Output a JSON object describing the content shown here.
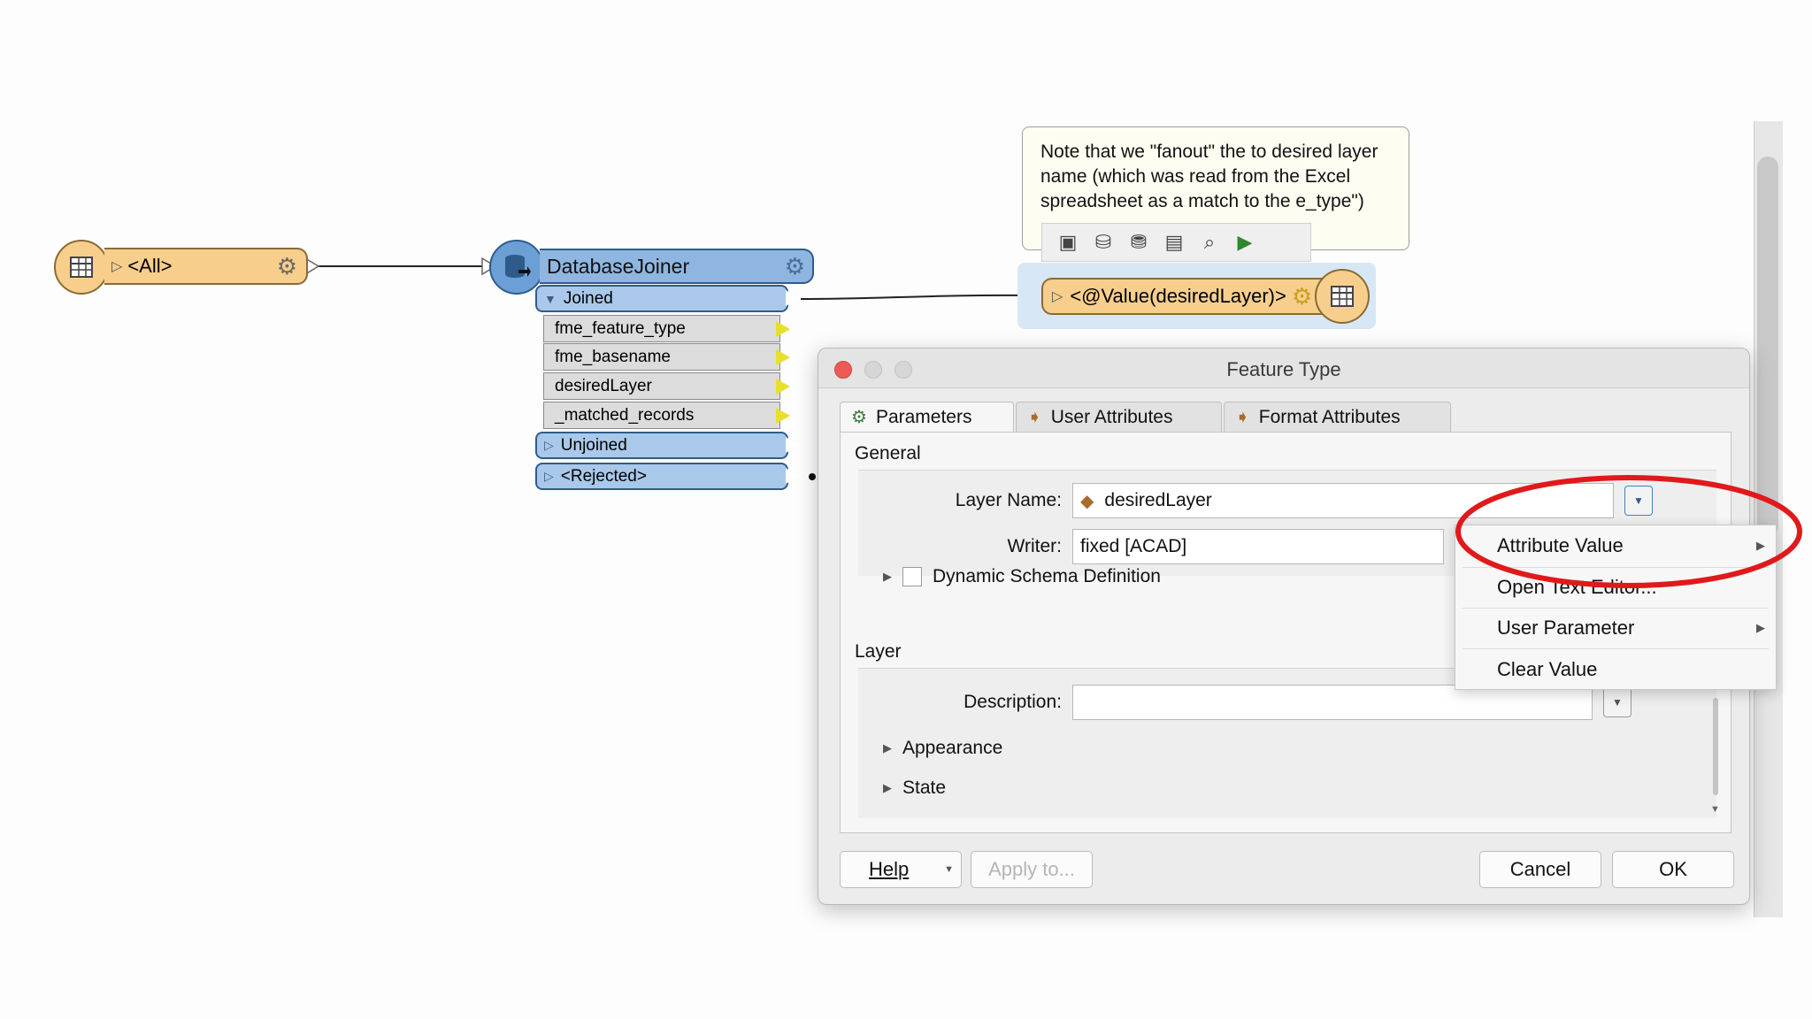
{
  "canvas": {
    "reader": {
      "label": "<All>"
    },
    "joiner": {
      "title": "DatabaseJoiner",
      "ports": {
        "joined": "Joined",
        "unjoined": "Unjoined",
        "rejected": "<Rejected>"
      },
      "attributes": [
        "fme_feature_type",
        "fme_basename",
        "desiredLayer",
        "_matched_records"
      ]
    },
    "annotation": {
      "text": "Note that we \"fanout\" the to desired layer name (which was read from the Excel spreadsheet as a match to the                                      e_type\")"
    },
    "writer": {
      "label": "<@Value(desiredLayer)>"
    }
  },
  "dialog": {
    "title": "Feature Type",
    "tabs": [
      "Parameters",
      "User Attributes",
      "Format Attributes"
    ],
    "general": {
      "heading": "General",
      "layer_name_label": "Layer Name:",
      "layer_name_value": "desiredLayer",
      "writer_label": "Writer:",
      "writer_value": "fixed [ACAD]",
      "dynamic_schema_label": "Dynamic Schema Definition"
    },
    "layer": {
      "heading": "Layer",
      "description_label": "Description:",
      "description_value": "",
      "appearance_label": "Appearance",
      "state_label": "State"
    },
    "buttons": {
      "help": "Help",
      "apply": "Apply to...",
      "cancel": "Cancel",
      "ok": "OK"
    }
  },
  "context_menu": {
    "items": [
      "Attribute Value",
      "Open Text Editor...",
      "User Parameter",
      "Clear Value"
    ]
  },
  "colors": {
    "reader_fill": "#f7ce8c",
    "joiner_fill": "#8fb6e0",
    "highlight_ellipse": "#e0191b",
    "close_light": "#ee5b56"
  },
  "icons": {
    "reader": "table-icon",
    "joiner": "database-icon",
    "writer": "table-icon",
    "settings": "gear-icon"
  }
}
